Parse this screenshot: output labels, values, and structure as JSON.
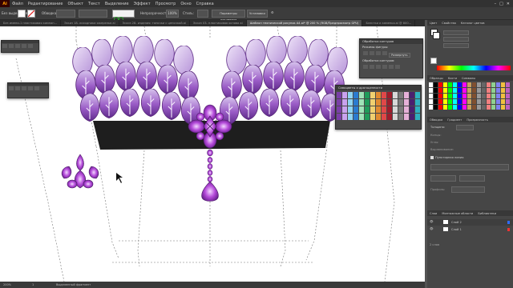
{
  "app": {
    "logo": "Ai"
  },
  "menu": [
    "Файл",
    "Редактирование",
    "Объект",
    "Текст",
    "Выделение",
    "Эффект",
    "Просмотр",
    "Окно",
    "Справка"
  ],
  "control_bar": {
    "selection_label": "Без выделения",
    "style_label": "Обводка:",
    "opacity_label": "Непрозрачность:",
    "opacity_value": "100%",
    "style_value": "Стиль:",
    "doc_setup_button": "Параметры документа",
    "prefs_button": "Установки"
  },
  "tabs": [
    {
      "label": "Без имени-1 пластиковая компан...",
      "active": false
    },
    {
      "label": "Эскиз 18- исходники ожерелья ai",
      "active": false
    },
    {
      "label": "Эскиз 28- изделия: тапочки с цепочкой.ai",
      "active": false
    },
    {
      "label": "Эскиз 03- пластиковая основа ai",
      "active": false
    },
    {
      "label": "Шаблон технический рисунок А4.ai* @ 200 % (RGB/Предпросмотр GPU)",
      "active": true
    },
    {
      "label": "Блестки и каменья.ai @ 800...",
      "active": false
    }
  ],
  "status": {
    "zoom": "200%",
    "page": "1",
    "tool": "Выделенный фрагмент"
  },
  "panels": {
    "color_tab": "Цвет",
    "guide_tab": "Свойства",
    "color_guide": "Каталог цветов",
    "swatches_tab": "Образцы",
    "brushes_tab": "Кисти",
    "symbols_tab": "Символы",
    "stroke_tab": "Обводка",
    "gradient_tab": "Градиент",
    "transparency_tab": "Прозрачность",
    "weight_label": "Толщина:",
    "cap_label": "Концы:",
    "corner_label": "Углы:",
    "align_label": "Выравнивание:",
    "dashed_label": "Пунктирная линия",
    "profile_label": "Профиль:",
    "layers_tab": "Слои",
    "artboards_tab": "Монтажные области",
    "libraries_tab": "Библиотеки",
    "layers": [
      {
        "name": "Слой 2"
      },
      {
        "name": "Слой 1"
      }
    ],
    "layers_count": "2 слоя"
  },
  "float_panels": {
    "pathfinder": {
      "title": "Обработка контуров",
      "shape_modes": "Режимы фигуры:",
      "expand_button": "Развернуть",
      "pathfinders": "Обработка контуров:"
    },
    "swatch_lib": {
      "title": "Самоцветы и драгоценности"
    }
  },
  "colors": {
    "petal_light": "#c9b3e3",
    "petal_mid": "#9a5cc6",
    "petal_dark": "#5e2a8a",
    "band": "#1e1e1e",
    "gem": "#a23ccc"
  }
}
